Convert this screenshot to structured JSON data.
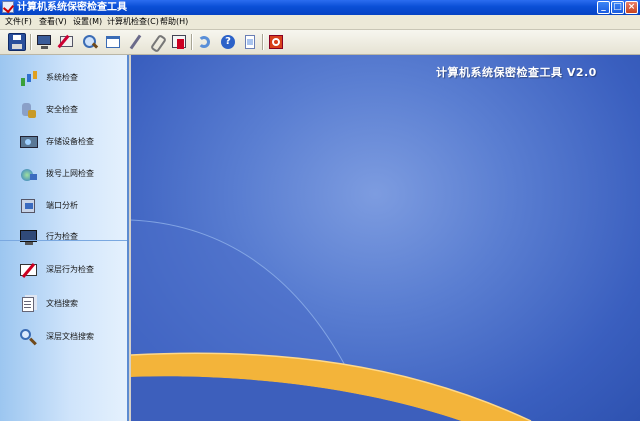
{
  "window": {
    "title": "计算机系统保密检查工具",
    "controls": {
      "minimize": "_",
      "maximize": "□",
      "close": "×"
    }
  },
  "menu": [
    {
      "label": "文件(F)"
    },
    {
      "label": "查看(V)"
    },
    {
      "label": "设置(M)"
    },
    {
      "label": "计算机检查(C)"
    },
    {
      "label": "帮助(H)"
    }
  ],
  "toolbar": {
    "icons": [
      "save-icon",
      "monitor-icon",
      "edit-icon",
      "search-icon",
      "window-icon",
      "pen-icon",
      "clip-icon",
      "tools-icon",
      "back-icon",
      "help-icon",
      "document-icon",
      "exit-icon"
    ]
  },
  "sidebar": {
    "items": [
      {
        "label": "系统检查",
        "icon": "system-check-icon"
      },
      {
        "label": "安全检查",
        "icon": "security-check-icon"
      },
      {
        "label": "存储设备检查",
        "icon": "storage-device-icon"
      },
      {
        "label": "拨号上网检查",
        "icon": "dialup-network-icon"
      },
      {
        "label": "端口分析",
        "icon": "port-analysis-icon"
      },
      {
        "label": "行为检查",
        "icon": "behavior-check-icon"
      },
      {
        "label": "深层行为检查",
        "icon": "deep-behavior-icon"
      },
      {
        "label": "文档搜索",
        "icon": "document-search-icon"
      },
      {
        "label": "深层文档搜索",
        "icon": "deep-document-search-icon"
      }
    ]
  },
  "main": {
    "app_title": "计算机系统保密检查工具  V2.0"
  },
  "colors": {
    "titlebar": "#0a4fd6",
    "sidebar": "#cfe4fb",
    "background": "#5b7fd2",
    "swoosh": "#f3b43a"
  }
}
